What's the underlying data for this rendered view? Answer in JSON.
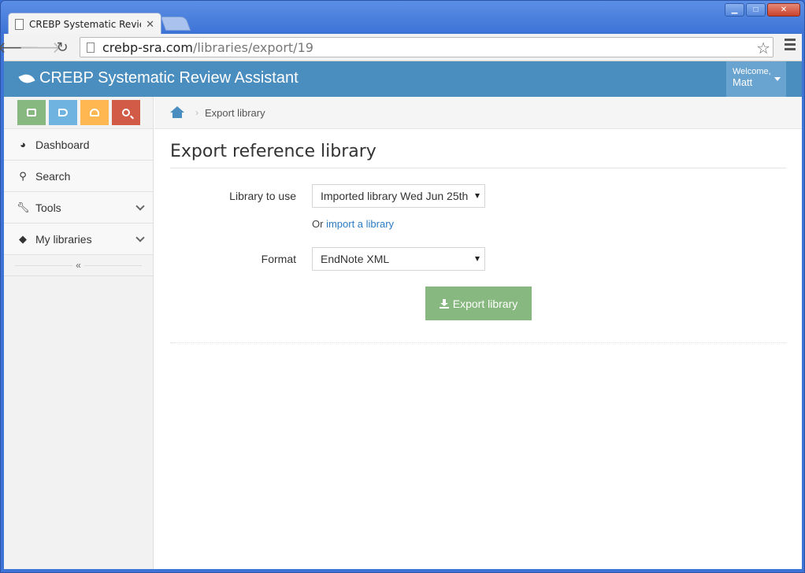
{
  "browser": {
    "tab_title": "CREBP Systematic Revie",
    "url_host": "crebp-sra.com",
    "url_path": "/libraries/export/19"
  },
  "app": {
    "brand": "CREBP Systematic Review Assistant",
    "user_welcome": "Welcome,",
    "user_name": "Matt",
    "accent": "#4a8dbf"
  },
  "sidebar": {
    "items": [
      {
        "label": "Dashboard",
        "icon": "dashboard-icon"
      },
      {
        "label": "Search",
        "icon": "search-icon"
      },
      {
        "label": "Tools",
        "icon": "wrench-icon"
      },
      {
        "label": "My libraries",
        "icon": "tags-icon"
      }
    ],
    "collapse": "«"
  },
  "breadcrumb": {
    "current": "Export library"
  },
  "main": {
    "title": "Export reference library",
    "library_label": "Library to use",
    "library_value": "Imported library Wed Jun 25th",
    "or_text": "Or",
    "import_link": "import a library",
    "format_label": "Format",
    "format_value": "EndNote XML",
    "export_button": "Export library"
  }
}
